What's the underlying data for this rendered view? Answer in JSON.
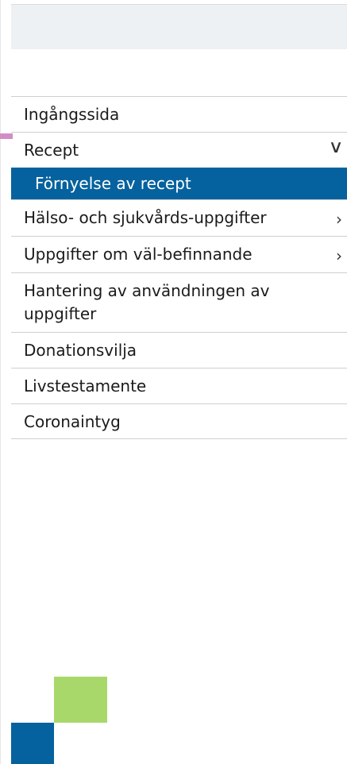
{
  "nav": {
    "items": [
      {
        "label": "Ingångssida"
      },
      {
        "label": "Recept",
        "chevron": "∨"
      },
      {
        "label": "Förnyelse av recept",
        "active": true
      },
      {
        "label": "Hälso- och sjukvårds-uppgifter",
        "chevron": "›"
      },
      {
        "label": "Uppgifter om väl-befinnande",
        "chevron": "›"
      },
      {
        "label": "Hantering av användningen av uppgifter"
      },
      {
        "label": "Donationsvilja"
      },
      {
        "label": "Livstestamente"
      },
      {
        "label": "Coronaintyg"
      }
    ]
  },
  "colors": {
    "accent_blue": "#05629e",
    "accent_green": "#a8d86a",
    "header_band": "#edf1f4",
    "pink_marker": "#d28dc4"
  },
  "icons": {
    "expanded": "chevron-down-icon",
    "collapsed": "chevron-right-icon"
  }
}
